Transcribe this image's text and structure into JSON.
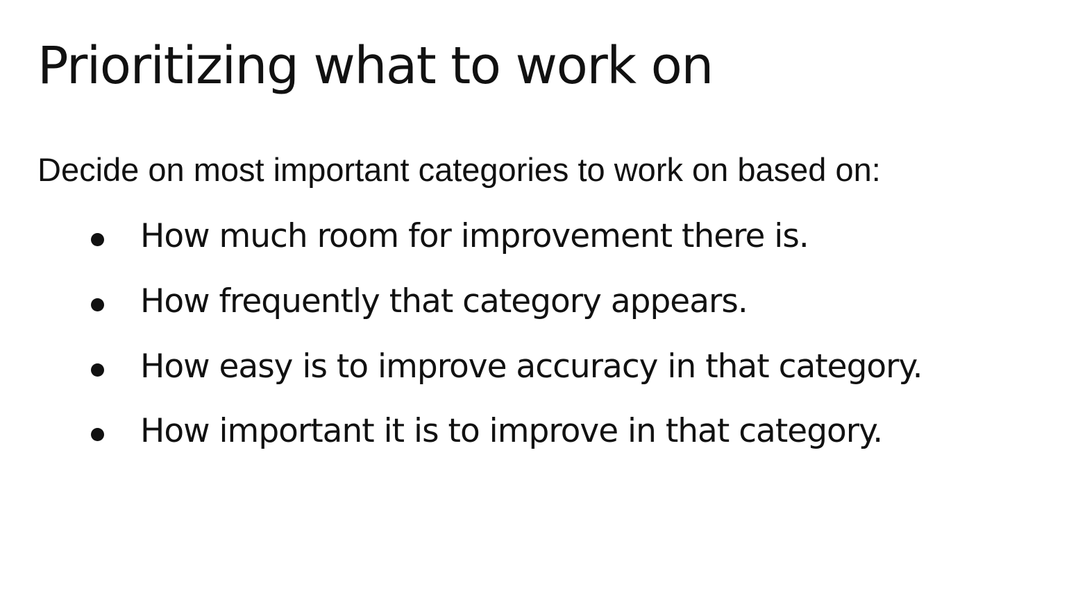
{
  "slide": {
    "title": "Prioritizing what to work on",
    "intro": "Decide on most important categories to work on based on:",
    "bullets": [
      "How much room for improvement there is.",
      "How frequently that category appears.",
      "How easy is to improve accuracy in that category.",
      "How important it is to improve in that category."
    ]
  }
}
